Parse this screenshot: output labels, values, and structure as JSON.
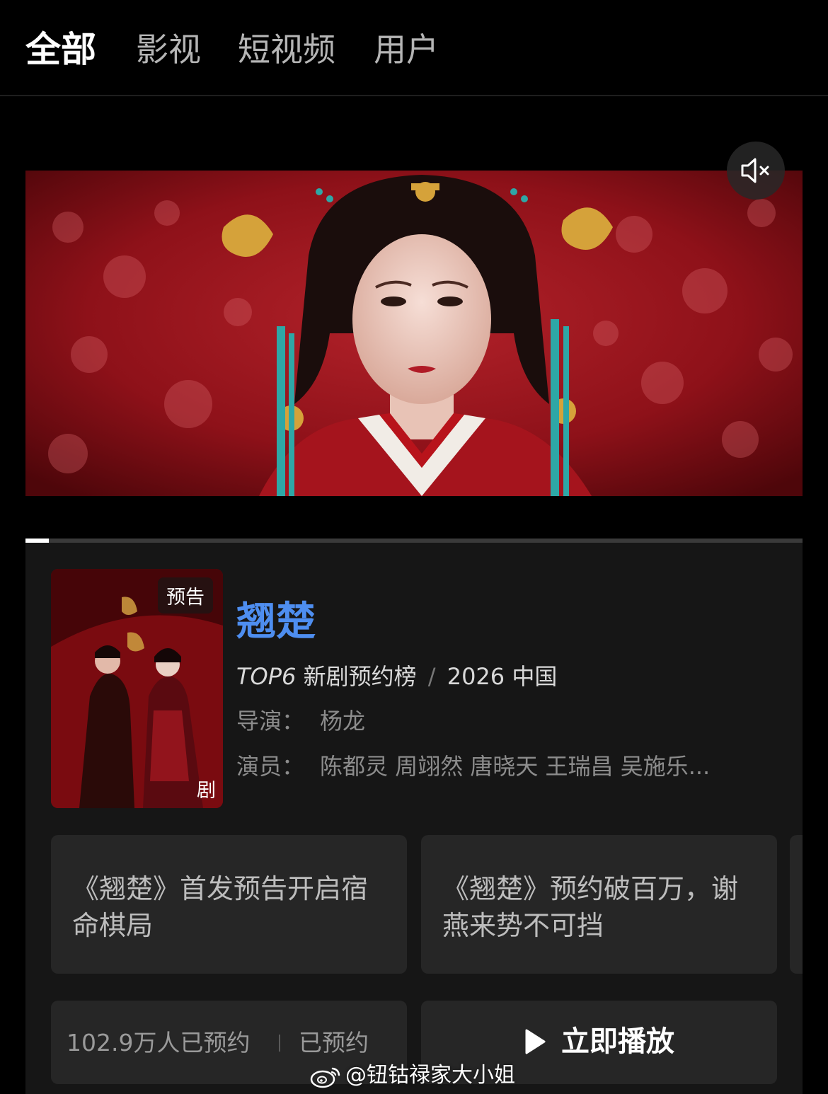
{
  "tabs": [
    {
      "label": "全部",
      "active": true
    },
    {
      "label": "影视",
      "active": false
    },
    {
      "label": "短视频",
      "active": false
    },
    {
      "label": "用户",
      "active": false
    }
  ],
  "video": {
    "progress": 0.03,
    "muted": true,
    "mute_icon": "speaker-muted-icon"
  },
  "show": {
    "badge": "预告",
    "type": "剧",
    "title": "翘楚",
    "rank": "TOP6",
    "chart": "新剧预约榜",
    "year_region": "2026 中国",
    "director_label": "导演：",
    "director": "杨龙",
    "cast_label": "演员：",
    "cast": "陈都灵 周翊然 唐晓天 王瑞昌 吴施乐..."
  },
  "news": [
    {
      "text": "《翘楚》首发预告开启宿命棋局"
    },
    {
      "text": "《翘楚》预约破百万，谢燕来势不可挡"
    }
  ],
  "actions": {
    "reserve_count": "102.9万人已预约",
    "reserve_status": "已预约",
    "play_label": "立即播放",
    "play_icon": "play-icon"
  },
  "watermark": {
    "text": "@钮钴禄家大小姐",
    "icon": "weibo-icon"
  },
  "colors": {
    "title_blue": "#4e8ef0",
    "card_bg": "#161616",
    "tile_bg": "#262626"
  }
}
